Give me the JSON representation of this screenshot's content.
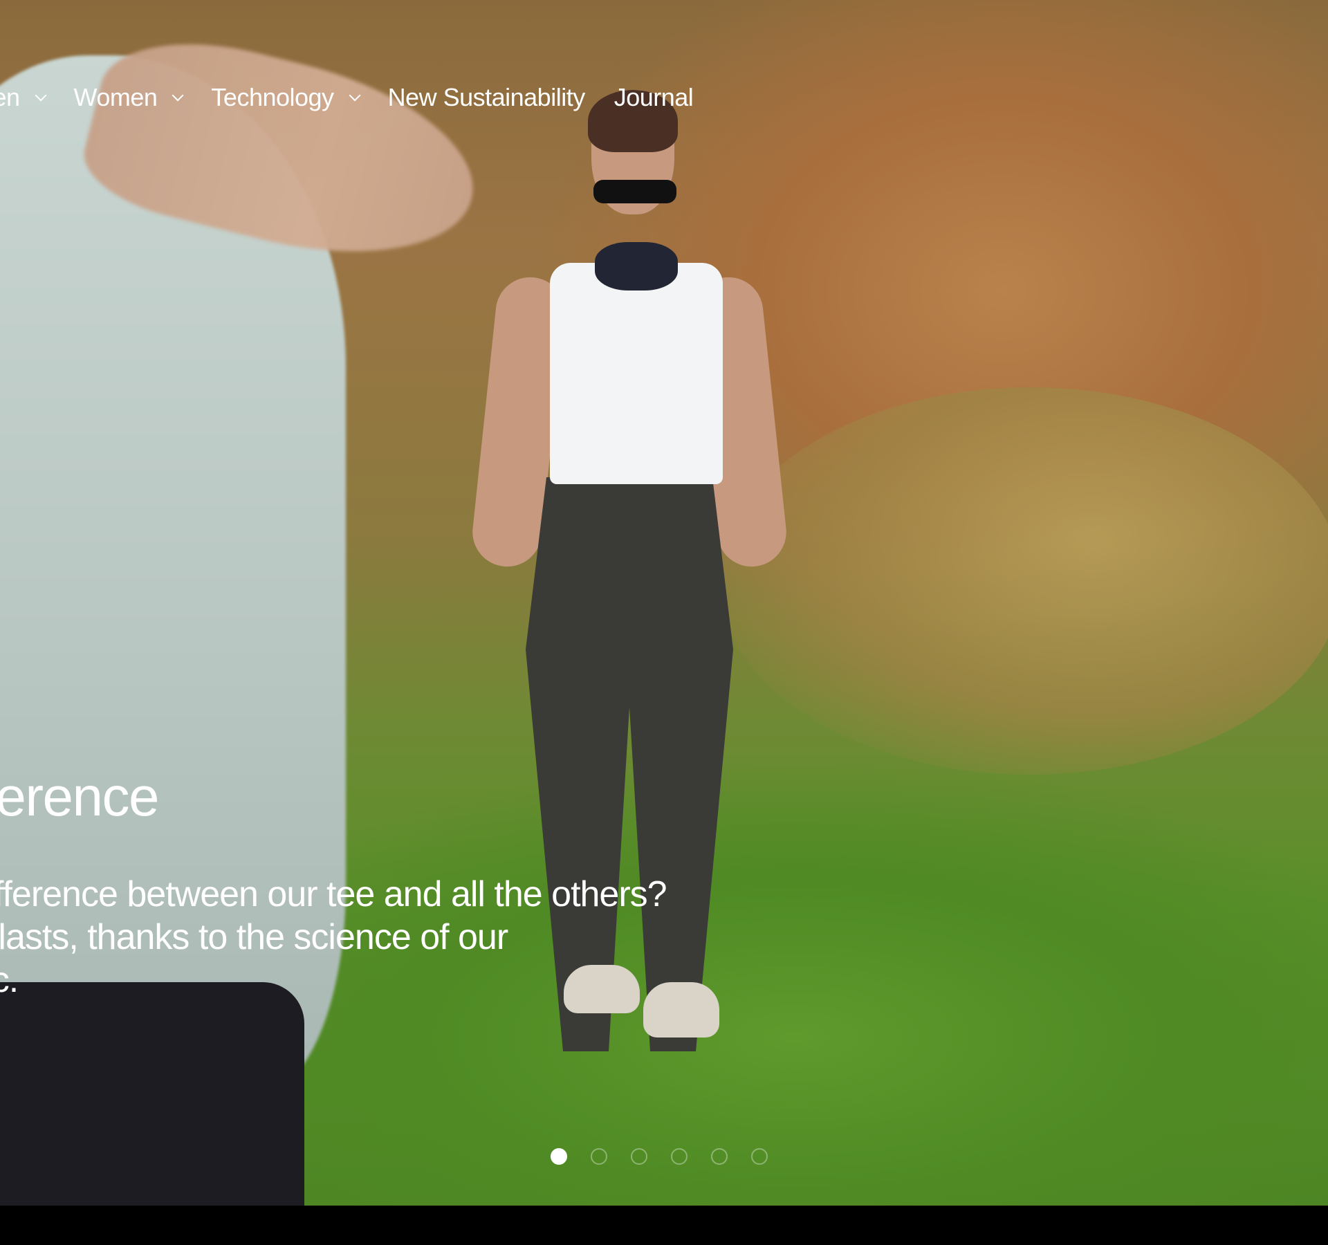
{
  "nav": {
    "items": [
      {
        "label": "Men",
        "has_dropdown": true
      },
      {
        "label": "Women",
        "has_dropdown": true
      },
      {
        "label": "Technology",
        "has_dropdown": true
      },
      {
        "label": "New Sustainability",
        "has_dropdown": false
      },
      {
        "label": "Journal",
        "has_dropdown": false
      }
    ],
    "chevron_icon": "chevron-down-icon"
  },
  "hero": {
    "title": "The difference",
    "description_lines": [
      "What's the difference between our tee and all the others?",
      "Clothing that lasts, thanks to the science of our",
      "long-life fabric."
    ]
  },
  "carousel": {
    "total_slides": 6,
    "active_index": 0
  },
  "colors": {
    "text": "#ffffff",
    "dot_inactive": "rgba(255,255,255,0.35)",
    "bottom_bar": "#000000"
  }
}
